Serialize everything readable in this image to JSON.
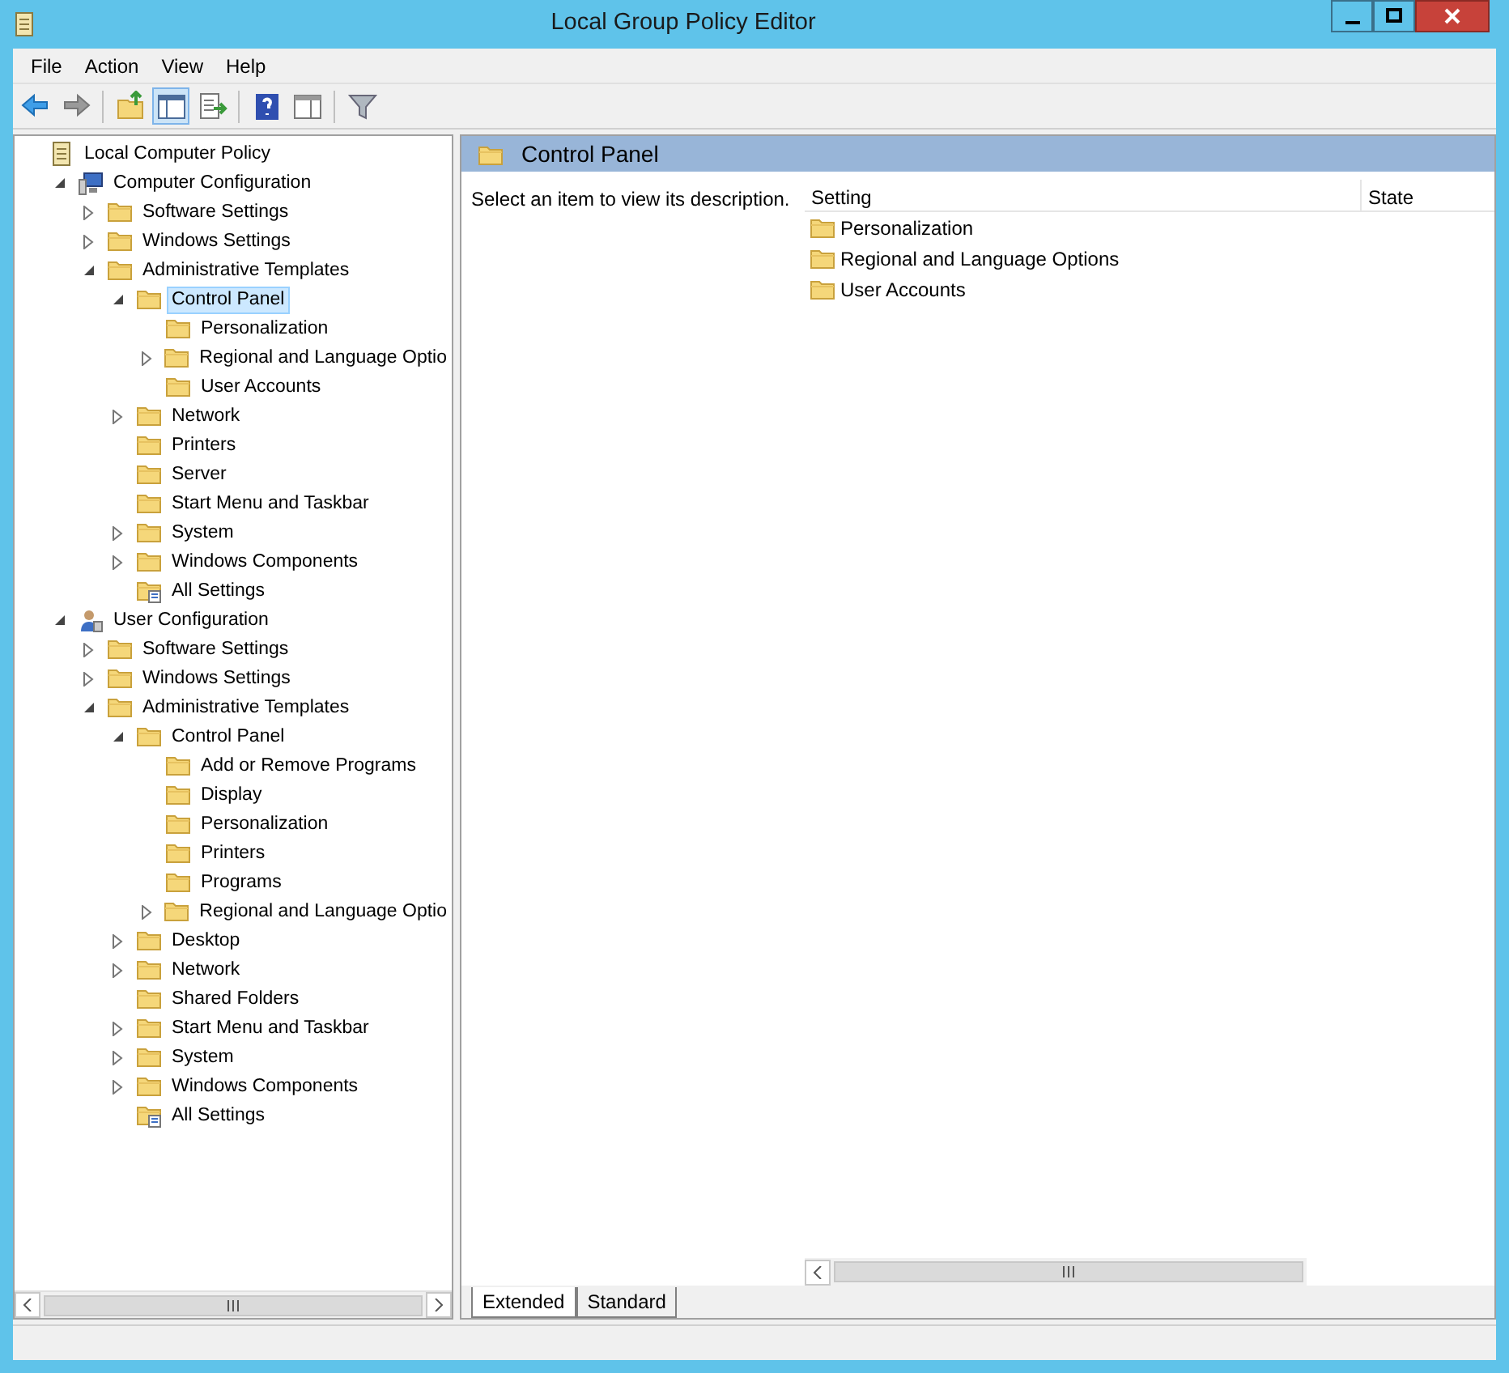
{
  "window": {
    "title": "Local Group Policy Editor"
  },
  "menu": [
    "File",
    "Action",
    "View",
    "Help"
  ],
  "toolbar": [
    {
      "kind": "back"
    },
    {
      "kind": "forward"
    },
    {
      "kind": "sep"
    },
    {
      "kind": "up"
    },
    {
      "kind": "pane",
      "selected": true
    },
    {
      "kind": "export"
    },
    {
      "kind": "sep"
    },
    {
      "kind": "help"
    },
    {
      "kind": "pane2"
    },
    {
      "kind": "sep"
    },
    {
      "kind": "filter"
    }
  ],
  "tree": [
    {
      "label": "Local Computer Policy",
      "kind": "policy",
      "selected": false,
      "children": [
        {
          "label": "Computer Configuration",
          "kind": "computer",
          "expanded": true,
          "selected": false,
          "children": [
            {
              "label": "Software Settings",
              "kind": "folder",
              "expanded": false,
              "selected": false
            },
            {
              "label": "Windows Settings",
              "kind": "folder",
              "expanded": false,
              "selected": false
            },
            {
              "label": "Administrative Templates",
              "kind": "folder",
              "expanded": true,
              "selected": false,
              "children": [
                {
                  "label": "Control Panel",
                  "kind": "folder",
                  "expanded": true,
                  "selected": true,
                  "children": [
                    {
                      "label": "Personalization",
                      "kind": "folder",
                      "selected": false
                    },
                    {
                      "label": "Regional and Language Optio",
                      "kind": "folder",
                      "expanded": false,
                      "selected": false
                    },
                    {
                      "label": "User Accounts",
                      "kind": "folder",
                      "selected": false
                    }
                  ]
                },
                {
                  "label": "Network",
                  "kind": "folder",
                  "expanded": false,
                  "selected": false
                },
                {
                  "label": "Printers",
                  "kind": "folder",
                  "selected": false
                },
                {
                  "label": "Server",
                  "kind": "folder",
                  "selected": false
                },
                {
                  "label": "Start Menu and Taskbar",
                  "kind": "folder",
                  "selected": false
                },
                {
                  "label": "System",
                  "kind": "folder",
                  "expanded": false,
                  "selected": false
                },
                {
                  "label": "Windows Components",
                  "kind": "folder",
                  "expanded": false,
                  "selected": false
                },
                {
                  "label": "All Settings",
                  "kind": "settings",
                  "selected": false
                }
              ]
            }
          ]
        },
        {
          "label": "User Configuration",
          "kind": "user",
          "expanded": true,
          "selected": false,
          "children": [
            {
              "label": "Software Settings",
              "kind": "folder",
              "expanded": false,
              "selected": false
            },
            {
              "label": "Windows Settings",
              "kind": "folder",
              "expanded": false,
              "selected": false
            },
            {
              "label": "Administrative Templates",
              "kind": "folder",
              "expanded": true,
              "selected": false,
              "children": [
                {
                  "label": "Control Panel",
                  "kind": "folder",
                  "expanded": true,
                  "selected": false,
                  "children": [
                    {
                      "label": "Add or Remove Programs",
                      "kind": "folder",
                      "selected": false
                    },
                    {
                      "label": "Display",
                      "kind": "folder",
                      "selected": false
                    },
                    {
                      "label": "Personalization",
                      "kind": "folder",
                      "selected": false
                    },
                    {
                      "label": "Printers",
                      "kind": "folder",
                      "selected": false
                    },
                    {
                      "label": "Programs",
                      "kind": "folder",
                      "selected": false
                    },
                    {
                      "label": "Regional and Language Optio",
                      "kind": "folder",
                      "expanded": false,
                      "selected": false
                    }
                  ]
                },
                {
                  "label": "Desktop",
                  "kind": "folder",
                  "expanded": false,
                  "selected": false
                },
                {
                  "label": "Network",
                  "kind": "folder",
                  "expanded": false,
                  "selected": false
                },
                {
                  "label": "Shared Folders",
                  "kind": "folder",
                  "selected": false
                },
                {
                  "label": "Start Menu and Taskbar",
                  "kind": "folder",
                  "expanded": false,
                  "selected": false
                },
                {
                  "label": "System",
                  "kind": "folder",
                  "expanded": false,
                  "selected": false
                },
                {
                  "label": "Windows Components",
                  "kind": "folder",
                  "expanded": false,
                  "selected": false
                },
                {
                  "label": "All Settings",
                  "kind": "settings",
                  "selected": false
                }
              ]
            }
          ]
        }
      ]
    }
  ],
  "details": {
    "title": "Control Panel",
    "description": "Select an item to view its description.",
    "columns": [
      "Setting",
      "State"
    ],
    "rows": [
      "Personalization",
      "Regional and Language Options",
      "User Accounts"
    ]
  },
  "view_tabs": [
    {
      "label": "Extended",
      "selected": true
    },
    {
      "label": "Standard",
      "selected": false
    }
  ]
}
